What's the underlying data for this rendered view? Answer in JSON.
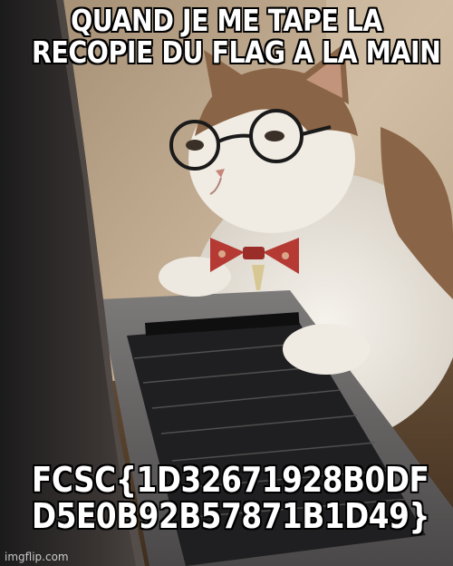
{
  "meme": {
    "top_text": [
      "QUAND JE ME TAPE LA",
      "RECOPIE DU FLAG A LA MAIN"
    ],
    "bottom_text": [
      "FCSC{1D32671928B0DF",
      "D5E0B92B57871B1D49}"
    ],
    "watermark": "imgflip.com"
  },
  "image": {
    "subject": "cat wearing round glasses and bow tie typing on laptop",
    "icons": [
      "cat-image",
      "glasses-icon",
      "bow-tie-icon",
      "laptop-keyboard"
    ]
  },
  "colors": {
    "caption_fill": "#ffffff",
    "caption_outline": "#000000",
    "wall": "#c9b49a",
    "laptop_dark": "#2b2b2e",
    "cat_white": "#ece7df",
    "cat_brown": "#8a6446",
    "bow_tie": "#b43a33"
  }
}
